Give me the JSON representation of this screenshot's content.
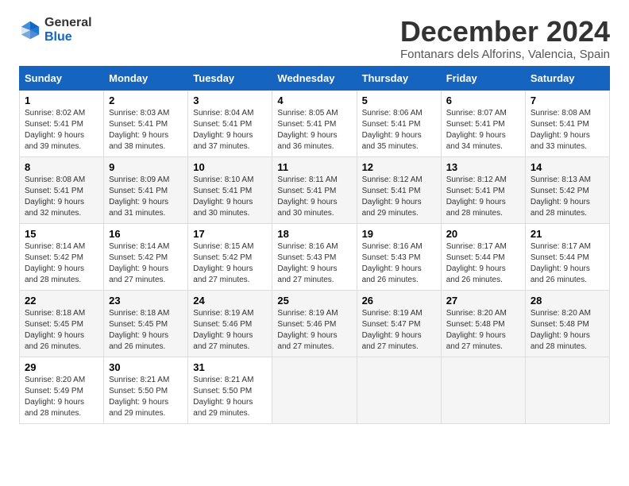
{
  "logo": {
    "general": "General",
    "blue": "Blue"
  },
  "title": "December 2024",
  "location": "Fontanars dels Alforins, Valencia, Spain",
  "days_of_week": [
    "Sunday",
    "Monday",
    "Tuesday",
    "Wednesday",
    "Thursday",
    "Friday",
    "Saturday"
  ],
  "weeks": [
    [
      {
        "day": "1",
        "sunrise": "Sunrise: 8:02 AM",
        "sunset": "Sunset: 5:41 PM",
        "daylight": "Daylight: 9 hours and 39 minutes."
      },
      {
        "day": "2",
        "sunrise": "Sunrise: 8:03 AM",
        "sunset": "Sunset: 5:41 PM",
        "daylight": "Daylight: 9 hours and 38 minutes."
      },
      {
        "day": "3",
        "sunrise": "Sunrise: 8:04 AM",
        "sunset": "Sunset: 5:41 PM",
        "daylight": "Daylight: 9 hours and 37 minutes."
      },
      {
        "day": "4",
        "sunrise": "Sunrise: 8:05 AM",
        "sunset": "Sunset: 5:41 PM",
        "daylight": "Daylight: 9 hours and 36 minutes."
      },
      {
        "day": "5",
        "sunrise": "Sunrise: 8:06 AM",
        "sunset": "Sunset: 5:41 PM",
        "daylight": "Daylight: 9 hours and 35 minutes."
      },
      {
        "day": "6",
        "sunrise": "Sunrise: 8:07 AM",
        "sunset": "Sunset: 5:41 PM",
        "daylight": "Daylight: 9 hours and 34 minutes."
      },
      {
        "day": "7",
        "sunrise": "Sunrise: 8:08 AM",
        "sunset": "Sunset: 5:41 PM",
        "daylight": "Daylight: 9 hours and 33 minutes."
      }
    ],
    [
      {
        "day": "8",
        "sunrise": "Sunrise: 8:08 AM",
        "sunset": "Sunset: 5:41 PM",
        "daylight": "Daylight: 9 hours and 32 minutes."
      },
      {
        "day": "9",
        "sunrise": "Sunrise: 8:09 AM",
        "sunset": "Sunset: 5:41 PM",
        "daylight": "Daylight: 9 hours and 31 minutes."
      },
      {
        "day": "10",
        "sunrise": "Sunrise: 8:10 AM",
        "sunset": "Sunset: 5:41 PM",
        "daylight": "Daylight: 9 hours and 30 minutes."
      },
      {
        "day": "11",
        "sunrise": "Sunrise: 8:11 AM",
        "sunset": "Sunset: 5:41 PM",
        "daylight": "Daylight: 9 hours and 30 minutes."
      },
      {
        "day": "12",
        "sunrise": "Sunrise: 8:12 AM",
        "sunset": "Sunset: 5:41 PM",
        "daylight": "Daylight: 9 hours and 29 minutes."
      },
      {
        "day": "13",
        "sunrise": "Sunrise: 8:12 AM",
        "sunset": "Sunset: 5:41 PM",
        "daylight": "Daylight: 9 hours and 28 minutes."
      },
      {
        "day": "14",
        "sunrise": "Sunrise: 8:13 AM",
        "sunset": "Sunset: 5:42 PM",
        "daylight": "Daylight: 9 hours and 28 minutes."
      }
    ],
    [
      {
        "day": "15",
        "sunrise": "Sunrise: 8:14 AM",
        "sunset": "Sunset: 5:42 PM",
        "daylight": "Daylight: 9 hours and 28 minutes."
      },
      {
        "day": "16",
        "sunrise": "Sunrise: 8:14 AM",
        "sunset": "Sunset: 5:42 PM",
        "daylight": "Daylight: 9 hours and 27 minutes."
      },
      {
        "day": "17",
        "sunrise": "Sunrise: 8:15 AM",
        "sunset": "Sunset: 5:42 PM",
        "daylight": "Daylight: 9 hours and 27 minutes."
      },
      {
        "day": "18",
        "sunrise": "Sunrise: 8:16 AM",
        "sunset": "Sunset: 5:43 PM",
        "daylight": "Daylight: 9 hours and 27 minutes."
      },
      {
        "day": "19",
        "sunrise": "Sunrise: 8:16 AM",
        "sunset": "Sunset: 5:43 PM",
        "daylight": "Daylight: 9 hours and 26 minutes."
      },
      {
        "day": "20",
        "sunrise": "Sunrise: 8:17 AM",
        "sunset": "Sunset: 5:44 PM",
        "daylight": "Daylight: 9 hours and 26 minutes."
      },
      {
        "day": "21",
        "sunrise": "Sunrise: 8:17 AM",
        "sunset": "Sunset: 5:44 PM",
        "daylight": "Daylight: 9 hours and 26 minutes."
      }
    ],
    [
      {
        "day": "22",
        "sunrise": "Sunrise: 8:18 AM",
        "sunset": "Sunset: 5:45 PM",
        "daylight": "Daylight: 9 hours and 26 minutes."
      },
      {
        "day": "23",
        "sunrise": "Sunrise: 8:18 AM",
        "sunset": "Sunset: 5:45 PM",
        "daylight": "Daylight: 9 hours and 26 minutes."
      },
      {
        "day": "24",
        "sunrise": "Sunrise: 8:19 AM",
        "sunset": "Sunset: 5:46 PM",
        "daylight": "Daylight: 9 hours and 27 minutes."
      },
      {
        "day": "25",
        "sunrise": "Sunrise: 8:19 AM",
        "sunset": "Sunset: 5:46 PM",
        "daylight": "Daylight: 9 hours and 27 minutes."
      },
      {
        "day": "26",
        "sunrise": "Sunrise: 8:19 AM",
        "sunset": "Sunset: 5:47 PM",
        "daylight": "Daylight: 9 hours and 27 minutes."
      },
      {
        "day": "27",
        "sunrise": "Sunrise: 8:20 AM",
        "sunset": "Sunset: 5:48 PM",
        "daylight": "Daylight: 9 hours and 27 minutes."
      },
      {
        "day": "28",
        "sunrise": "Sunrise: 8:20 AM",
        "sunset": "Sunset: 5:48 PM",
        "daylight": "Daylight: 9 hours and 28 minutes."
      }
    ],
    [
      {
        "day": "29",
        "sunrise": "Sunrise: 8:20 AM",
        "sunset": "Sunset: 5:49 PM",
        "daylight": "Daylight: 9 hours and 28 minutes."
      },
      {
        "day": "30",
        "sunrise": "Sunrise: 8:21 AM",
        "sunset": "Sunset: 5:50 PM",
        "daylight": "Daylight: 9 hours and 29 minutes."
      },
      {
        "day": "31",
        "sunrise": "Sunrise: 8:21 AM",
        "sunset": "Sunset: 5:50 PM",
        "daylight": "Daylight: 9 hours and 29 minutes."
      },
      null,
      null,
      null,
      null
    ]
  ]
}
